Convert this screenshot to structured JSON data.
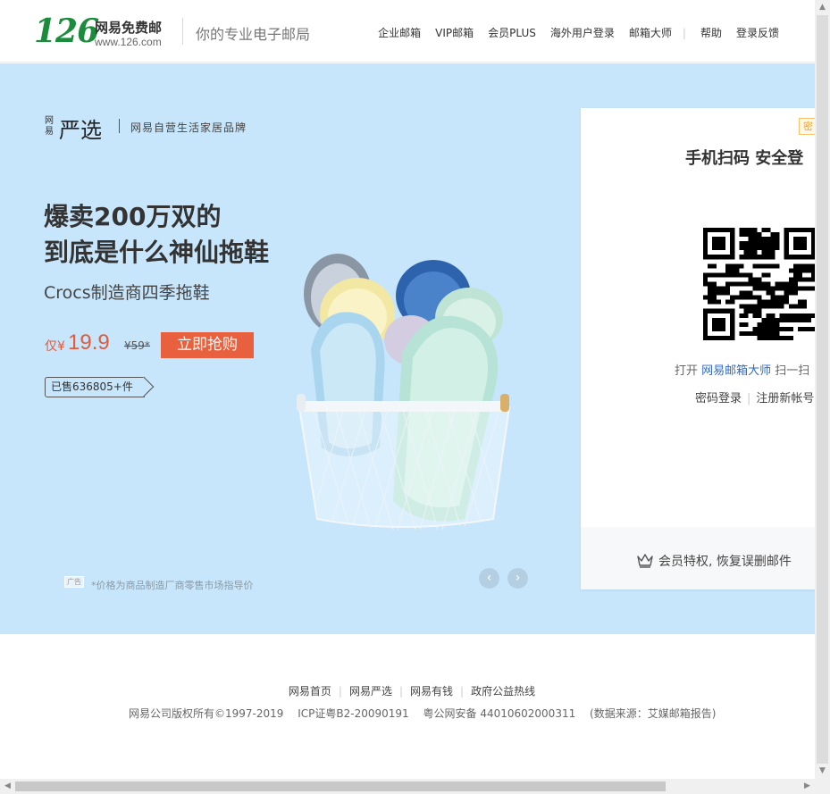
{
  "header": {
    "logo_number": "126",
    "logo_name": "网易免费邮",
    "logo_url": "www.126.com",
    "slogan": "你的专业电子邮局",
    "nav": [
      "企业邮箱",
      "VIP邮箱",
      "会员PLUS",
      "海外用户登录",
      "邮箱大师",
      "帮助",
      "登录反馈"
    ]
  },
  "banner": {
    "bg_color": "#c8e6fb",
    "brand_small": "网易",
    "brand_big": "严选",
    "brand_tag": "网易自营生活家居品牌",
    "headline_line1": "爆卖200万双的",
    "headline_line2": "到底是什么神仙拖鞋",
    "subline": "Crocs制造商四季拖鞋",
    "price_label": "仅¥",
    "price": "19.9",
    "original_price": "¥59*",
    "buy_button": "立即抢购",
    "sold": "已售636805+件",
    "ad_tag": "广告",
    "disclaimer": "*价格为商品制造厂商零售市场指导价",
    "prev_icon": "chevron-left-icon",
    "next_icon": "chevron-right-icon"
  },
  "login": {
    "corner_tab": "密",
    "title": "手机扫码 安全登",
    "hint_prefix": "打开 ",
    "hint_link": "网易邮箱大师",
    "hint_suffix": " 扫一扫",
    "password_login": "密码登录",
    "register": "注册新帐号",
    "vip_text": "会员特权, 恢复误删邮件",
    "vip_icon": "crown-icon"
  },
  "footer": {
    "links": [
      "网易首页",
      "网易严选",
      "网易有钱",
      "政府公益热线"
    ],
    "copyright": "网易公司版权所有©1997-2019",
    "icp": "ICP证粤B2-20090191",
    "police": "粤公网安备 44010602000311",
    "source": "(数据来源：艾媒邮箱报告)"
  },
  "colors": {
    "brand_green": "#1b8b3c",
    "accent_orange": "#e8603d",
    "link_blue": "#2f6ac6"
  }
}
